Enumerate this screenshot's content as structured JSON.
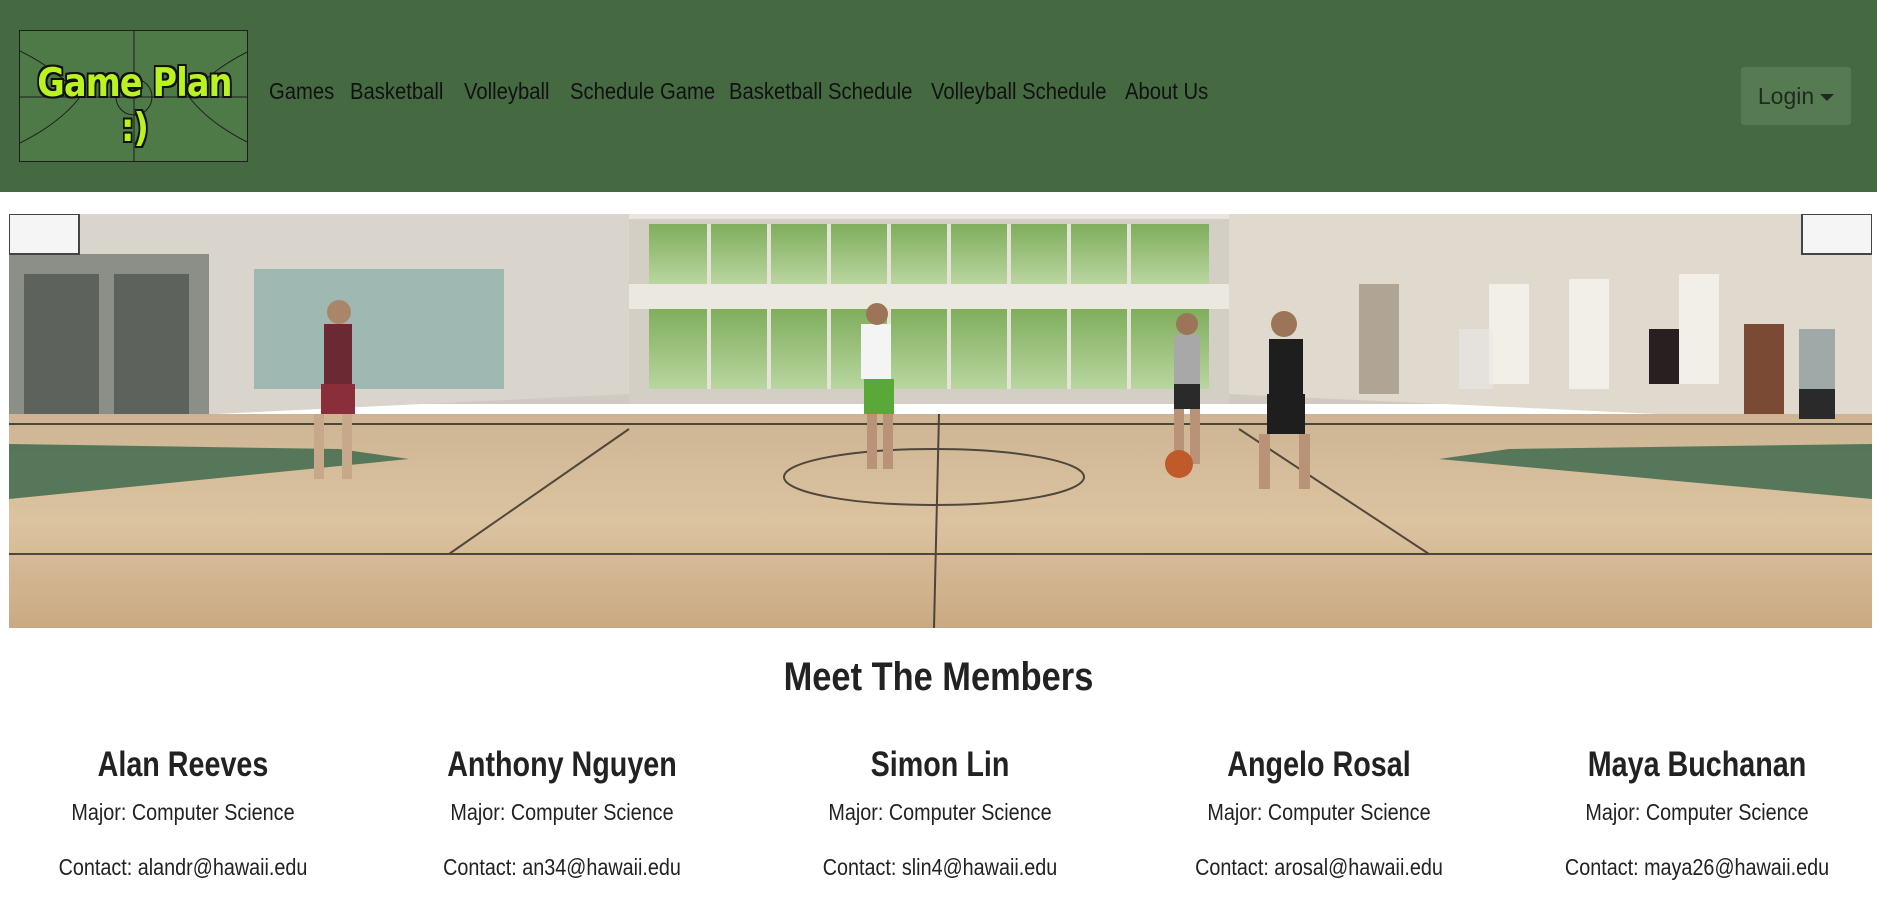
{
  "brand": {
    "logo_text": "Game Plan :)"
  },
  "nav": {
    "links": [
      {
        "label": "Games"
      },
      {
        "label": "Basketball"
      },
      {
        "label": "Volleyball"
      },
      {
        "label": "Schedule Game"
      },
      {
        "label": "Basketball Schedule"
      },
      {
        "label": "Volleyball Schedule"
      },
      {
        "label": "About Us"
      }
    ],
    "login_label": "Login"
  },
  "members_section": {
    "title": "Meet The Members",
    "members": [
      {
        "name": "Alan Reeves",
        "major": "Major: Computer Science",
        "contact": "Contact: alandr@hawaii.edu"
      },
      {
        "name": "Anthony Nguyen",
        "major": "Major: Computer Science",
        "contact": "Contact: an34@hawaii.edu"
      },
      {
        "name": "Simon Lin",
        "major": "Major: Computer Science",
        "contact": "Contact: slin4@hawaii.edu"
      },
      {
        "name": "Angelo Rosal",
        "major": "Major: Computer Science",
        "contact": "Contact: arosal@hawaii.edu"
      },
      {
        "name": "Maya Buchanan",
        "major": "Major: Computer Science",
        "contact": "Contact: maya26@hawaii.edu"
      }
    ]
  },
  "colors": {
    "navbar": "#456941",
    "login_button": "#567a52",
    "logo_text": "#b9f320"
  }
}
